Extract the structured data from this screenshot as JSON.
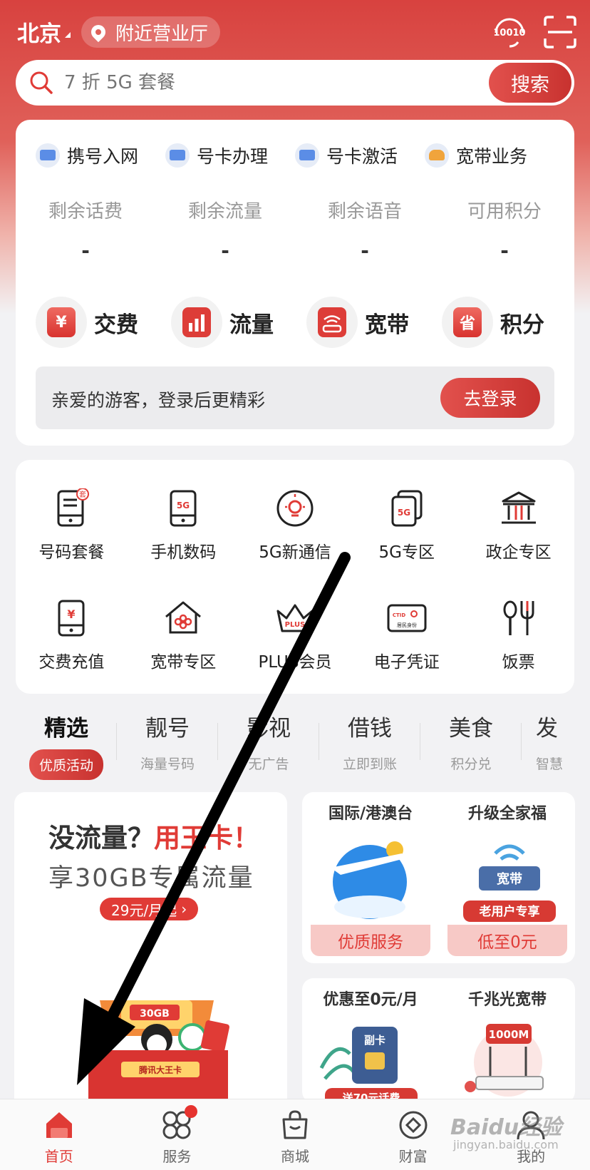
{
  "header": {
    "city": "北京",
    "nearby_label": "附近营业厅",
    "hotline_label": "10010"
  },
  "search": {
    "placeholder": "7 折 5G 套餐",
    "button_label": "搜索"
  },
  "quick_links": [
    {
      "label": "携号入网",
      "icon": "card-icon"
    },
    {
      "label": "号卡办理",
      "icon": "card-icon"
    },
    {
      "label": "号卡激活",
      "icon": "card-icon"
    },
    {
      "label": "宽带业务",
      "icon": "broadband-icon"
    }
  ],
  "stats": [
    {
      "label": "剩余话费",
      "value": "-"
    },
    {
      "label": "剩余流量",
      "value": "-"
    },
    {
      "label": "剩余语音",
      "value": "-"
    },
    {
      "label": "可用积分",
      "value": "-"
    }
  ],
  "big_actions": [
    {
      "label": "交费",
      "glyph": "¥"
    },
    {
      "label": "流量",
      "glyph": "▮"
    },
    {
      "label": "宽带",
      "glyph": "≋"
    },
    {
      "label": "积分",
      "glyph": "省"
    }
  ],
  "login_bar": {
    "text": "亲爱的游客，登录后更精彩",
    "button_label": "去登录"
  },
  "services": [
    {
      "label": "号码套餐",
      "icon": "phone-plan-icon"
    },
    {
      "label": "手机数码",
      "icon": "phone-5g-icon"
    },
    {
      "label": "5G新通信",
      "icon": "bulb-icon"
    },
    {
      "label": "5G专区",
      "icon": "5g-zone-icon"
    },
    {
      "label": "政企专区",
      "icon": "bank-icon"
    },
    {
      "label": "交费充值",
      "icon": "pay-phone-icon"
    },
    {
      "label": "宽带专区",
      "icon": "house-icon"
    },
    {
      "label": "PLUS会员",
      "icon": "crown-icon"
    },
    {
      "label": "电子凭证",
      "icon": "id-card-icon"
    },
    {
      "label": "饭票",
      "icon": "cutlery-icon"
    }
  ],
  "service_icon_text": {
    "plan_badge": "套",
    "five_g": "5G",
    "pay": "¥",
    "plus": "PLUS",
    "ctid": "CTID",
    "id_text": "居民身份"
  },
  "tabs": [
    {
      "title": "精选",
      "sub": "优质活动",
      "active": true
    },
    {
      "title": "靓号",
      "sub": "海量号码"
    },
    {
      "title": "影视",
      "sub": "无广告"
    },
    {
      "title": "借钱",
      "sub": "立即到账"
    },
    {
      "title": "美食",
      "sub": "积分兑"
    },
    {
      "title": "发",
      "sub": "智慧"
    }
  ],
  "promo_main": {
    "title_a": "没流量？",
    "title_b": "用王卡！",
    "subtitle": "享30GB专属流量",
    "price": "29元/月起",
    "gift_label": "腾讯大王卡",
    "gift_tag": "30GB"
  },
  "promo_cards": [
    {
      "title": "国际/港澳台",
      "tag": "优质服务"
    },
    {
      "title": "升级全家福",
      "tag": "低至0元",
      "banner": "老用户专享",
      "sign": "宽带"
    },
    {
      "title": "优惠至0元/月",
      "sign": "副卡",
      "banner": "送70元话费"
    },
    {
      "title": "千兆光宽带",
      "sign": "1000M"
    }
  ],
  "bottom_nav": [
    {
      "label": "首页",
      "active": true
    },
    {
      "label": "服务",
      "badge": true
    },
    {
      "label": "商城"
    },
    {
      "label": "财富"
    },
    {
      "label": "我的"
    }
  ],
  "watermark": {
    "text": "Baidu经验",
    "sub": "jingyan.baidu.com"
  },
  "colors": {
    "brand_red": "#e03b36",
    "header_red": "#d8423f",
    "annotation_arrow": "#000000"
  }
}
